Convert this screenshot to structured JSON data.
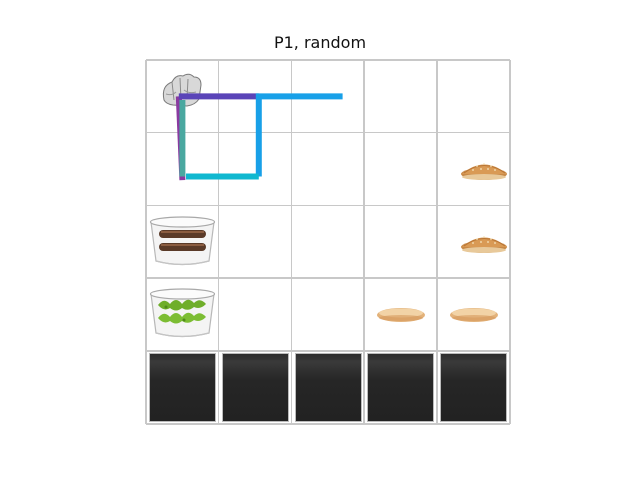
{
  "title": "P1, random",
  "grid": {
    "rows": 5,
    "cols": 5
  },
  "colors": {
    "grid_line": "#c8c8c8",
    "path_purple": "#8a3aa0",
    "path_indigo": "#5a44b8",
    "path_blue": "#18a0e8",
    "path_cyan": "#10b8d0",
    "path_teal": "#4aa8a0",
    "counter": "#262626"
  },
  "items": [
    {
      "type": "player-hand",
      "icon": "hand-icon",
      "row": 0,
      "col": 0
    },
    {
      "type": "bun",
      "icon": "bun-top-icon",
      "row": 1,
      "col": 4
    },
    {
      "type": "patty-container",
      "icon": "patty-container-icon",
      "row": 2,
      "col": 0
    },
    {
      "type": "bun",
      "icon": "bun-top-icon",
      "row": 2,
      "col": 4
    },
    {
      "type": "lettuce-container",
      "icon": "lettuce-container-icon",
      "row": 3,
      "col": 0
    },
    {
      "type": "bun-bottom",
      "icon": "bun-bottom-icon",
      "row": 3,
      "col": 3
    },
    {
      "type": "bun-bottom",
      "icon": "bun-bottom-icon",
      "row": 3,
      "col": 4
    }
  ],
  "counters": {
    "row": 4,
    "cols": [
      0,
      1,
      2,
      3,
      4
    ]
  },
  "trajectories": [
    {
      "color": "path_purple",
      "points": [
        [
          0.45,
          0.5
        ],
        [
          0.5,
          1.65
        ],
        [
          0.5,
          1.65
        ]
      ]
    },
    {
      "color": "path_teal",
      "points": [
        [
          0.5,
          0.55
        ],
        [
          0.5,
          1.6
        ]
      ]
    },
    {
      "color": "path_indigo",
      "points": [
        [
          0.45,
          0.5
        ],
        [
          1.55,
          0.5
        ]
      ]
    },
    {
      "color": "path_blue",
      "points": [
        [
          1.55,
          1.6
        ],
        [
          1.55,
          0.5
        ],
        [
          2.7,
          0.5
        ]
      ]
    },
    {
      "color": "path_cyan",
      "points": [
        [
          0.55,
          1.6
        ],
        [
          1.55,
          1.6
        ]
      ]
    }
  ]
}
